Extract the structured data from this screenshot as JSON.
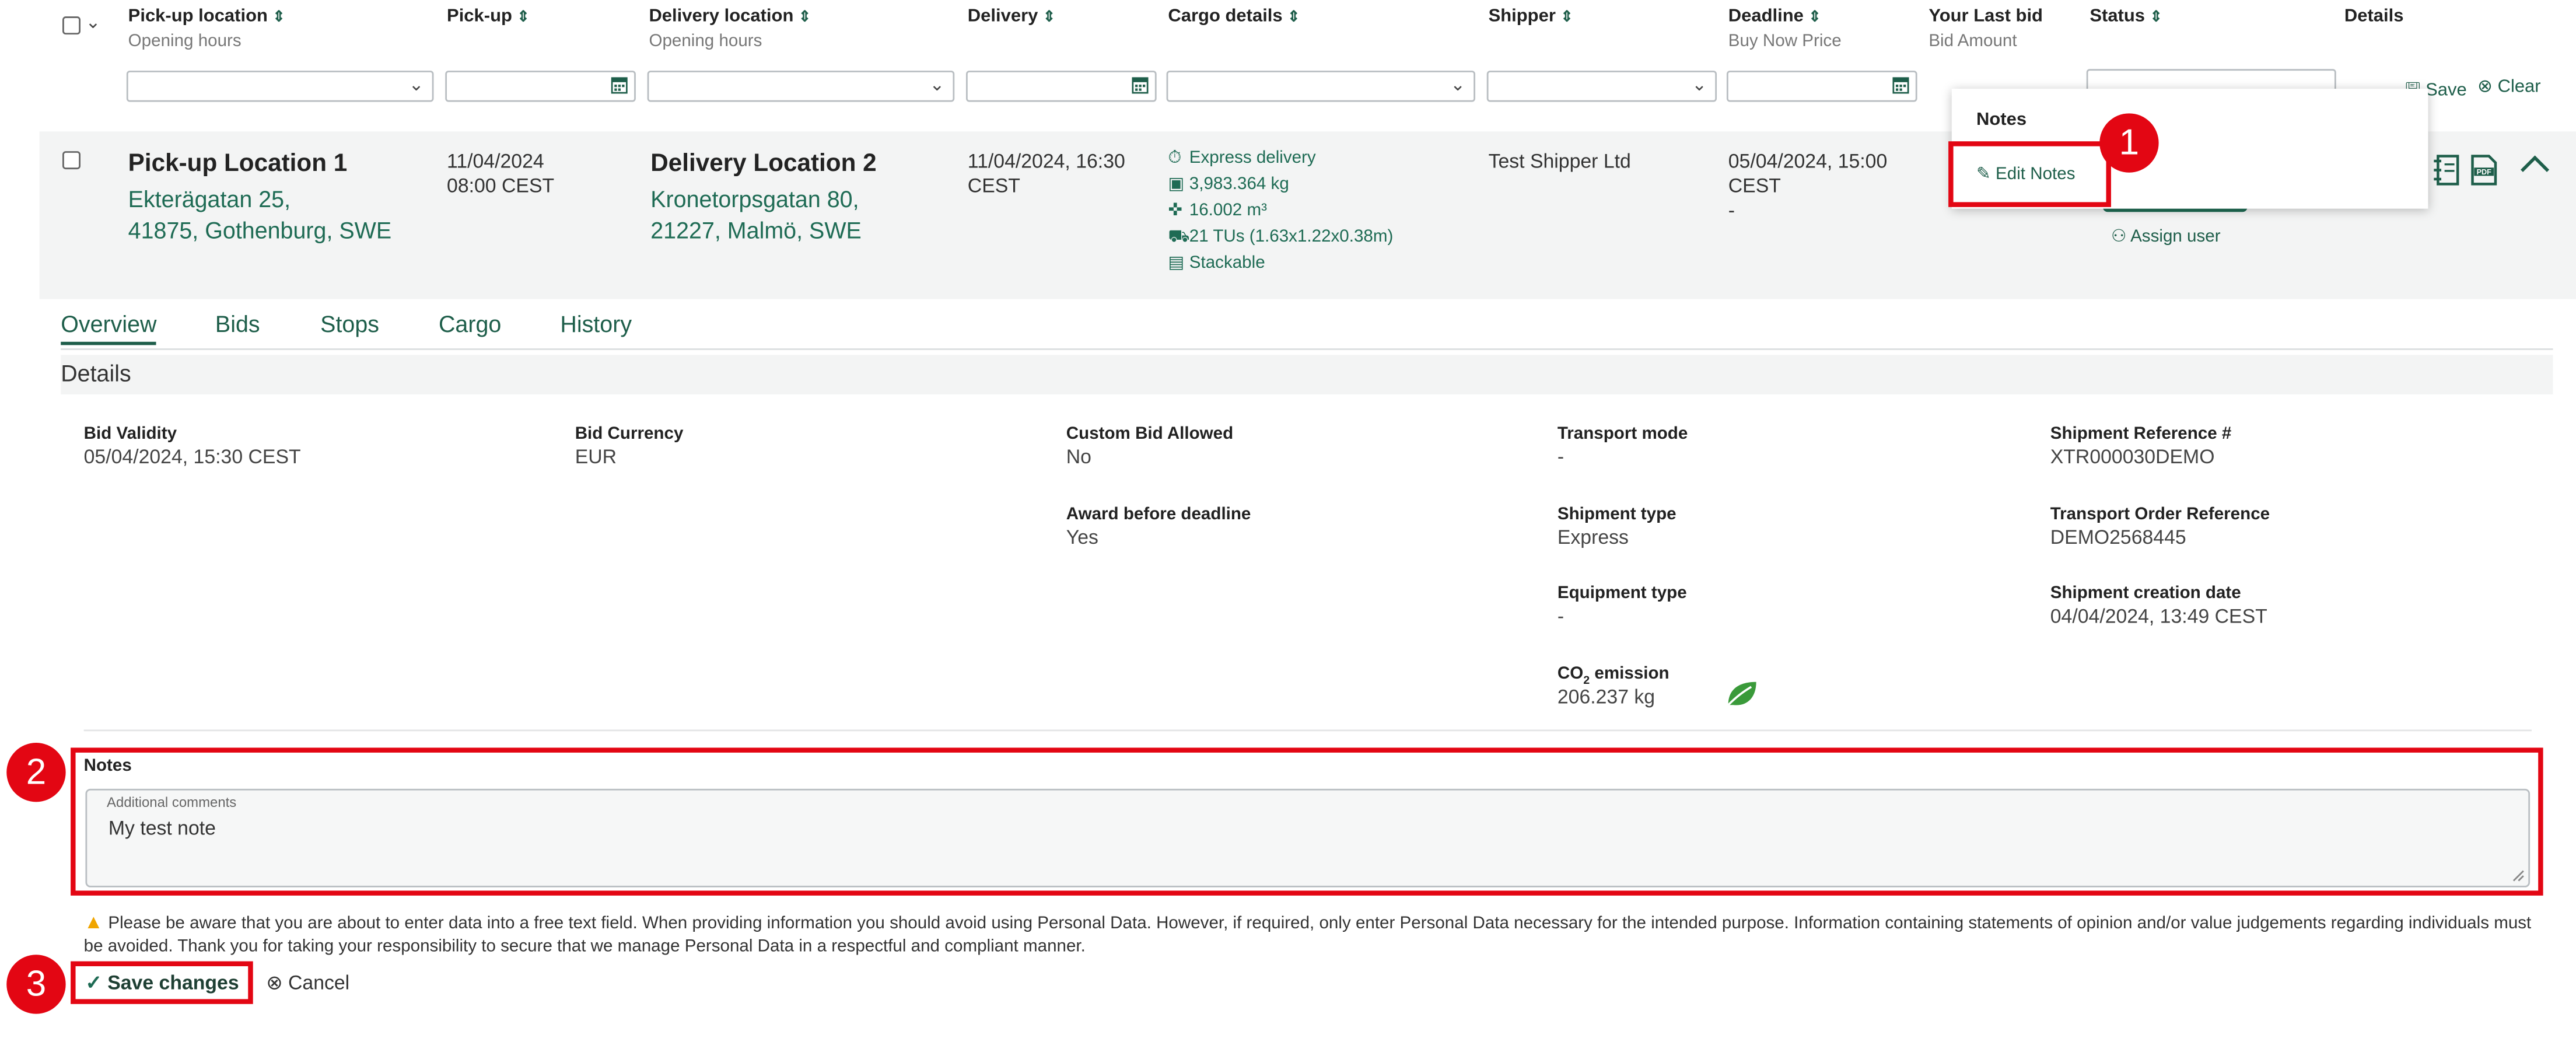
{
  "header": {
    "pickup_location": "Pick-up location",
    "pickup_location_sub": "Opening hours",
    "pickup": "Pick-up",
    "delivery_location": "Delivery location",
    "delivery_location_sub": "Opening hours",
    "delivery": "Delivery",
    "cargo_details": "Cargo details",
    "shipper": "Shipper",
    "deadline": "Deadline",
    "deadline_sub": "Buy Now Price",
    "your_last_bid": "Your Last bid",
    "your_last_bid_sub": "Bid Amount",
    "status": "Status",
    "details": "Details",
    "save": "Save",
    "clear": "Clear"
  },
  "row": {
    "pickup_title": "Pick-up Location 1",
    "pickup_addr1": "Ekterägatan 25,",
    "pickup_addr2": "41875, Gothenburg, SWE",
    "pickup_date": "11/04/2024",
    "pickup_time": "08:00 CEST",
    "delivery_title": "Delivery Location 2",
    "delivery_addr1": "Kronetorpsgatan 80,",
    "delivery_addr2": "21227, Malmö, SWE",
    "delivery_date": "11/04/2024, 16:30",
    "delivery_tz": "CEST",
    "cargo_express": "Express delivery",
    "cargo_weight": "3,983.364 kg",
    "cargo_volume": "16.002 m³",
    "cargo_tus": "21 TUs (1.63x1.22x0.38m)",
    "cargo_stackable": "Stackable",
    "shipper": "Test Shipper Ltd",
    "deadline_date": "05/04/2024, 15:00",
    "deadline_tz": "CEST",
    "buy_now": "-",
    "assign_user": "Assign user"
  },
  "popup": {
    "title": "Notes",
    "edit_notes": "Edit Notes"
  },
  "tabs": [
    "Overview",
    "Bids",
    "Stops",
    "Cargo",
    "History"
  ],
  "details_title": "Details",
  "fields": {
    "bid_validity_label": "Bid Validity",
    "bid_validity": "05/04/2024, 15:30 CEST",
    "bid_currency_label": "Bid Currency",
    "bid_currency": "EUR",
    "custom_bid_label": "Custom Bid Allowed",
    "custom_bid": "No",
    "award_label": "Award before deadline",
    "award": "Yes",
    "transport_mode_label": "Transport mode",
    "transport_mode": "-",
    "shipment_type_label": "Shipment type",
    "shipment_type": "Express",
    "equipment_type_label": "Equipment type",
    "equipment_type": "-",
    "co2_label_main": "CO",
    "co2_label_sub": "2",
    "co2_label_tail": " emission",
    "co2": "206.237 kg",
    "shipment_ref_label": "Shipment Reference #",
    "shipment_ref": "XTR000030DEMO",
    "transport_order_label": "Transport Order Reference",
    "transport_order": "DEMO2568445",
    "creation_label": "Shipment creation date",
    "creation": "04/04/2024, 13:49 CEST"
  },
  "notes": {
    "title": "Notes",
    "field_label": "Additional comments",
    "value": "My test note",
    "warning": "Please be aware that you are about to enter data into a free text field. When providing information you should avoid using Personal Data. However, if required, only enter Personal Data necessary for the intended purpose. Information containing statements of opinion and/or value judgements regarding individuals must be avoided. Thank you for taking your responsibility to secure that we manage Personal Data in a respectful and compliant manner.",
    "save_changes": "Save changes",
    "cancel": "Cancel"
  },
  "markers": [
    "1",
    "2",
    "3"
  ],
  "colors": {
    "accent": "#1e6b54",
    "annotation": "#e30613",
    "eco": "#3a9a3a"
  }
}
